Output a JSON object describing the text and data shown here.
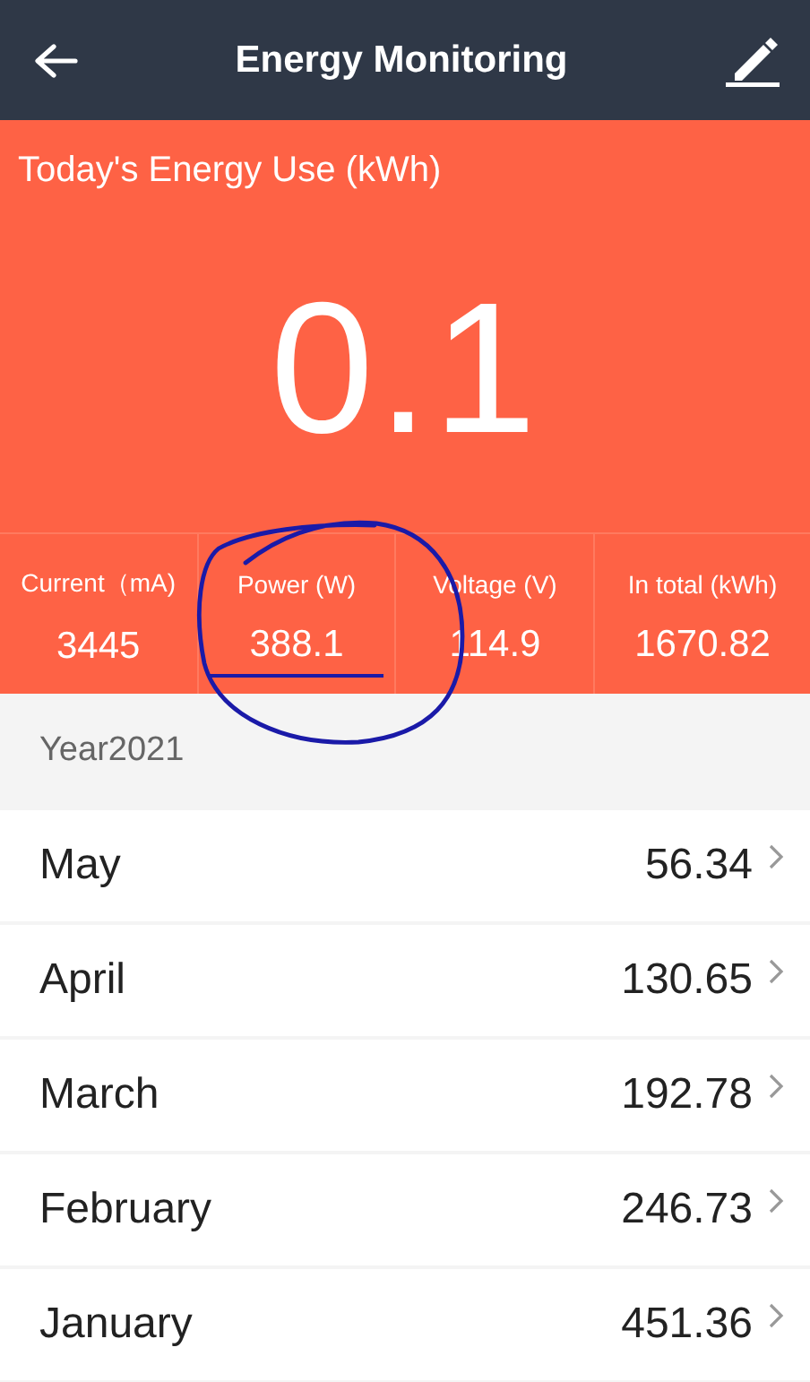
{
  "header": {
    "title": "Energy Monitoring"
  },
  "today": {
    "label": "Today's Energy Use (kWh)",
    "value": "0.1"
  },
  "stats": [
    {
      "label": "Current（mA)",
      "value": "3445",
      "circled": false
    },
    {
      "label": "Power (W)",
      "value": "388.1",
      "circled": true
    },
    {
      "label": "Voltage (V)",
      "value": "114.9",
      "circled": false
    },
    {
      "label": "In total (kWh)",
      "value": "1670.82",
      "circled": false
    }
  ],
  "year": {
    "label": "Year2021"
  },
  "months": [
    {
      "name": "May",
      "value": "56.34"
    },
    {
      "name": "April",
      "value": "130.65"
    },
    {
      "name": "March",
      "value": "192.78"
    },
    {
      "name": "February",
      "value": "246.73"
    },
    {
      "name": "January",
      "value": "451.36"
    }
  ]
}
